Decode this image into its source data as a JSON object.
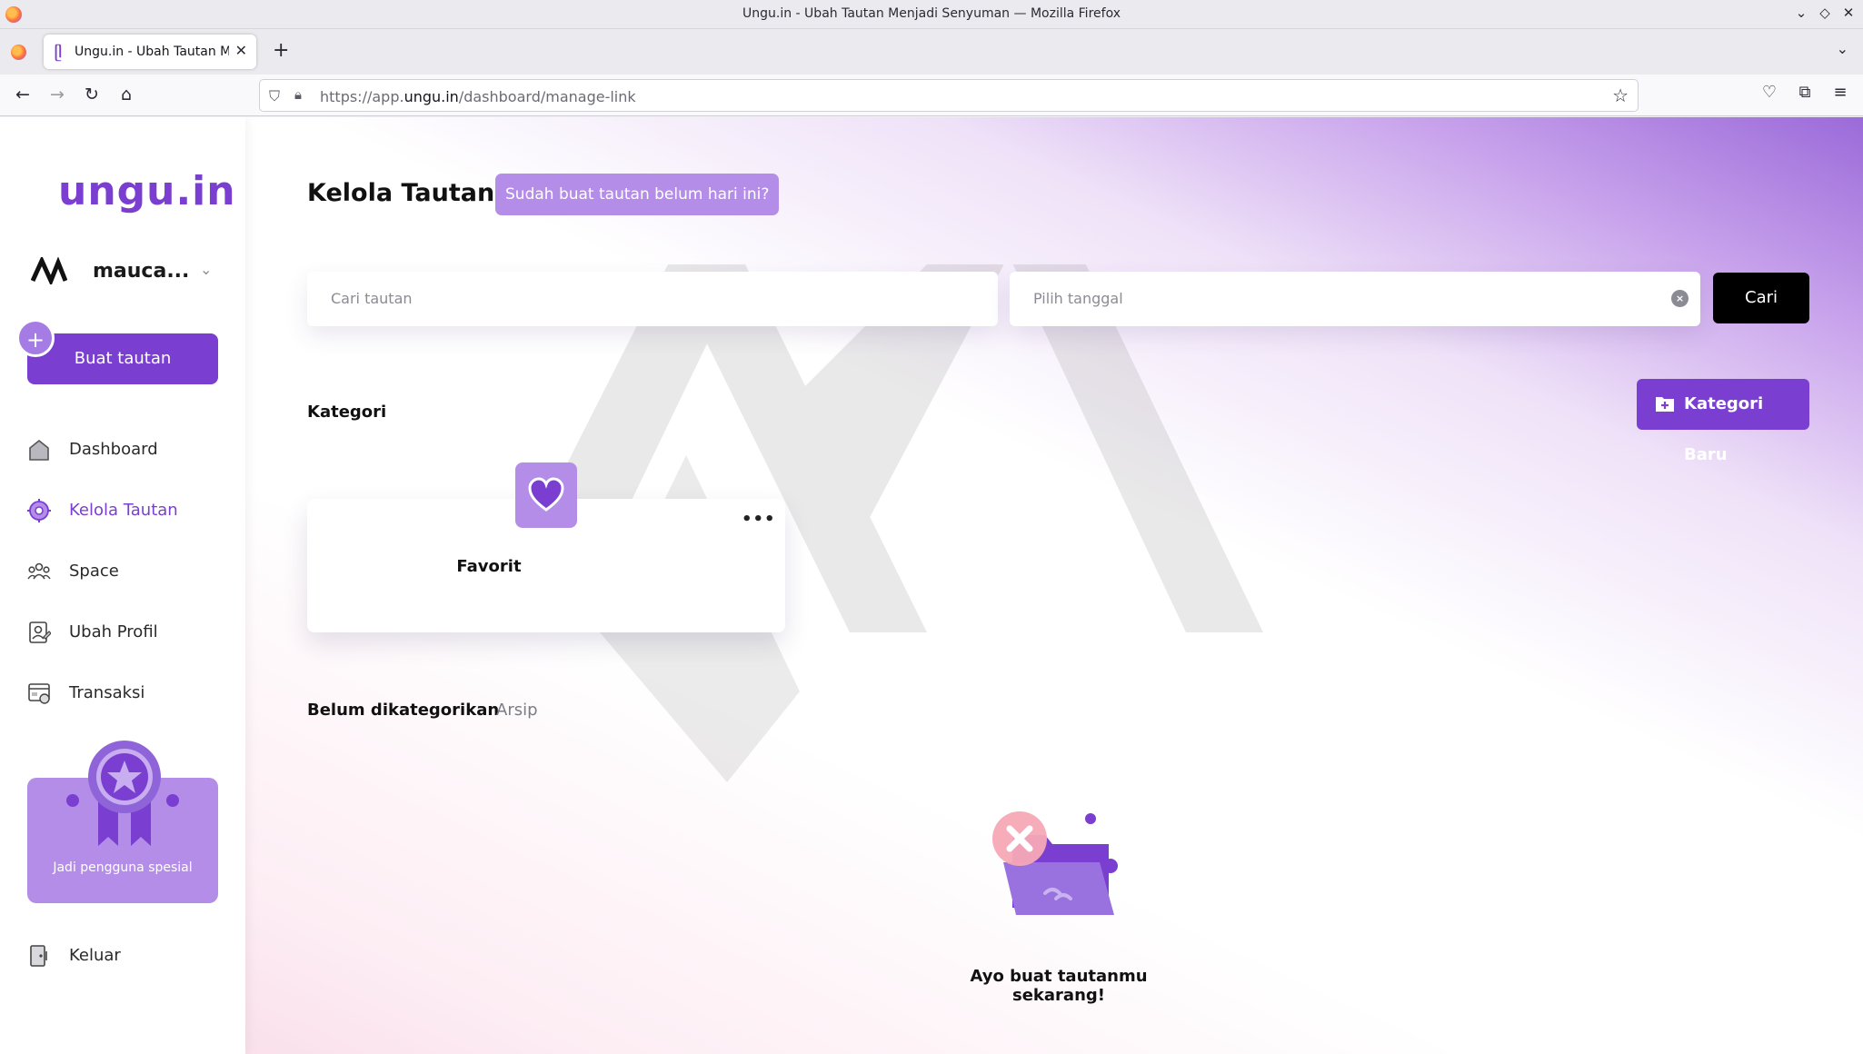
{
  "window": {
    "title": "Ungu.in - Ubah Tautan Menjadi Senyuman — Mozilla Firefox",
    "controls": [
      "⌄",
      "◇",
      "✕"
    ]
  },
  "browser": {
    "tab_title": "Ungu.in - Ubah Tautan Menjadi Senyuman",
    "url_prefix": "https://app.",
    "url_domain": "ungu.in",
    "url_path": "/dashboard/manage-link",
    "icons": [
      "back-icon",
      "forward-icon",
      "reload-icon",
      "home-icon",
      "shield-icon",
      "lock-icon",
      "bookmark-star-icon",
      "pocket-icon",
      "extensions-icon",
      "menu-icon"
    ]
  },
  "sidebar": {
    "logo": "ungu.in",
    "user_name": "mauca...",
    "create_button": "Buat tautan",
    "items": [
      {
        "label": "Dashboard",
        "icon": "home-icon",
        "active": false
      },
      {
        "label": "Kelola Tautan",
        "icon": "gear-link-icon",
        "active": true
      },
      {
        "label": "Space",
        "icon": "people-icon",
        "active": false
      },
      {
        "label": "Ubah Profil",
        "icon": "profile-icon",
        "active": false
      },
      {
        "label": "Transaksi",
        "icon": "transaction-icon",
        "active": false
      }
    ],
    "promo_text": "Jadi pengguna spesial",
    "logout": "Keluar"
  },
  "main": {
    "title": "Kelola Tautan",
    "hint": "Sudah buat tautan belum hari ini?",
    "search_placeholder": "Cari tautan",
    "date_placeholder": "Pilih tanggal",
    "search_button": "Cari",
    "category_heading": "Kategori",
    "new_category_button": "Kategori Baru",
    "categories": [
      {
        "name": "Favorit",
        "icon": "heart-icon"
      }
    ],
    "tabs": [
      {
        "label": "Belum dikategorikan",
        "active": true
      },
      {
        "label": "Arsip",
        "active": false
      }
    ],
    "empty_message": "Ayo buat tautanmu sekarang!"
  },
  "colors": {
    "brand": "#7a3fd1",
    "brand_light": "#b48de8",
    "dark_button": "#000000"
  }
}
